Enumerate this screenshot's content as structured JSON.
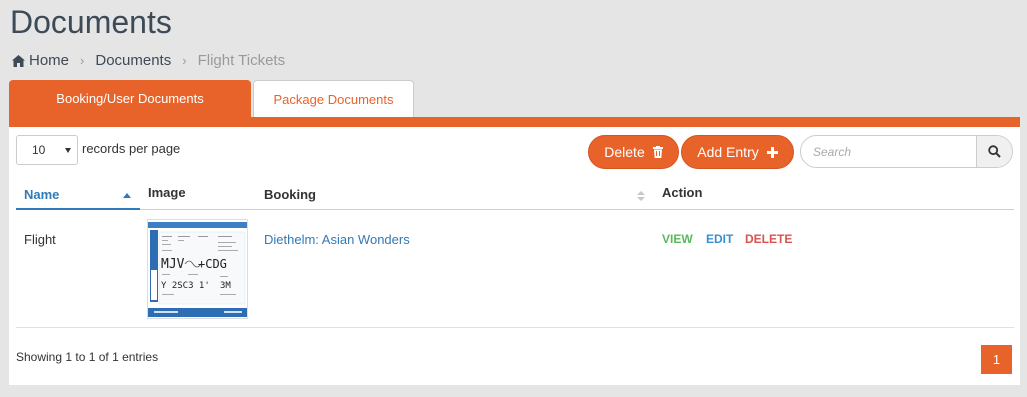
{
  "header": {
    "title": "Documents"
  },
  "breadcrumb": {
    "items": [
      "Home",
      "Documents",
      "Flight Tickets"
    ]
  },
  "tabs": [
    {
      "label": "Booking/User Documents",
      "active": true
    },
    {
      "label": "Package Documents",
      "active": false
    }
  ],
  "toolbar": {
    "length_value": "10",
    "length_label": "records per page",
    "delete_label": "Delete",
    "add_label": "Add Entry",
    "search_placeholder": "Search"
  },
  "table": {
    "columns": [
      "Name",
      "Image",
      "Booking",
      "Action"
    ],
    "sorted_column": "Name",
    "rows": [
      {
        "name": "Flight",
        "image": "flight-ticket-thumbnail",
        "booking": "Diethelm: Asian Wonders",
        "actions": [
          "VIEW",
          "EDIT",
          "DELETE"
        ]
      }
    ]
  },
  "footer": {
    "info": "Showing 1 to 1 of 1 entries",
    "current_page": "1"
  },
  "colors": {
    "accent": "#e8632a",
    "link": "#2f7ab8",
    "view": "#5cb85c",
    "edit": "#3a8fd0",
    "delete": "#d9534f"
  },
  "icons": [
    "home-icon",
    "chevron-right-icon",
    "trash-icon",
    "plus-icon",
    "search-icon",
    "sort-asc-icon",
    "sort-icon"
  ]
}
